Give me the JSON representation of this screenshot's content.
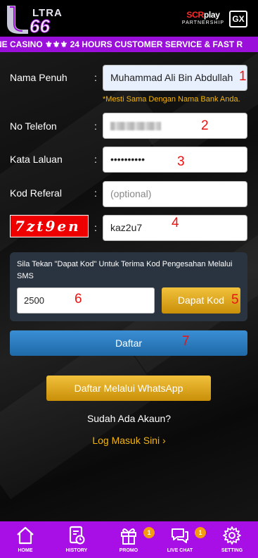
{
  "header": {
    "logo_text": "ULTRA 66",
    "partner_brand_a": "SCR",
    "partner_brand_b": "play",
    "partner_sub": "PARTNERSHIP",
    "gx_logo": "GX"
  },
  "marquee": "NE CASINO ⚜⚜⚜ 24 HOURS CUSTOMER SERVICE & FAST R",
  "form": {
    "full_name": {
      "label": "Nama Penuh",
      "colon": ":",
      "value": "Muhammad Ali Bin Abdullah",
      "note": "*Mesti Sama Dengan Nama Bank Anda.",
      "annotation": "1"
    },
    "phone": {
      "label": "No Telefon",
      "colon": ":",
      "annotation": "2"
    },
    "password": {
      "label": "Kata Laluan",
      "colon": ":",
      "value": "••••••••••",
      "annotation": "3"
    },
    "referral": {
      "label": "Kod Referal",
      "colon": ":",
      "placeholder": "(optional)"
    },
    "captcha": {
      "image_text": "7zt9en",
      "colon": ":",
      "value": "kaz2u7",
      "annotation": "4"
    }
  },
  "sms": {
    "instruction": "Sila Tekan \"Dapat Kod\" Untuk Terima Kod Pengesahan Melalui SMS",
    "code_value": "2500",
    "code_annotation": "6",
    "get_code_label": "Dapat Kod",
    "get_code_annotation": "5"
  },
  "register_button": {
    "label": "Daftar",
    "annotation": "7"
  },
  "whatsapp_button": "Daftar Melalui WhatsApp",
  "have_account": "Sudah Ada Akaun?",
  "login_link": "Log Masuk Sini",
  "tabbar": {
    "home": "HOME",
    "history": "HISTORY",
    "promo": "PROMO",
    "promo_badge": "1",
    "live_chat": "LIVE CHAT",
    "live_chat_badge": "1",
    "setting": "SETTING"
  },
  "colors": {
    "purple": "#a80fe6",
    "gold": "#f5b50a",
    "blue_button": "#2a7cc0",
    "annotation_red": "#e11"
  }
}
